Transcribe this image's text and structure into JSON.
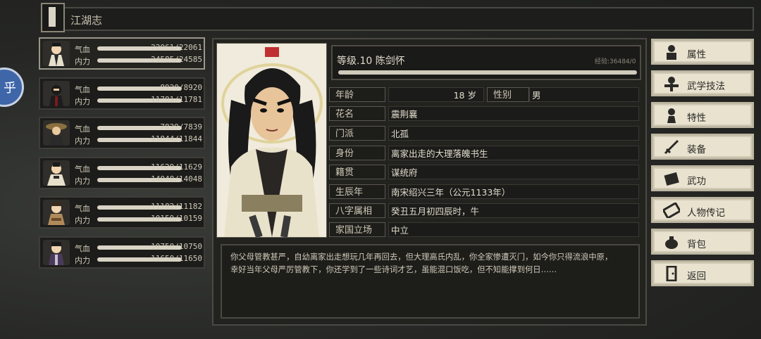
{
  "header": {
    "title": "江湖志"
  },
  "side": {
    "circle_char": "乎"
  },
  "roster": [
    {
      "hp_label": "气血",
      "mp_label": "内力",
      "hp": "22061/22061",
      "mp": "24585/24585",
      "active": true
    },
    {
      "hp_label": "气血",
      "mp_label": "内力",
      "hp": "8920/8920",
      "mp": "11781/11781",
      "active": false
    },
    {
      "hp_label": "气血",
      "mp_label": "内力",
      "hp": "7839/7839",
      "mp": "11844/11844",
      "active": false
    },
    {
      "hp_label": "气血",
      "mp_label": "内力",
      "hp": "11629/11629",
      "mp": "14048/14048",
      "active": false
    },
    {
      "hp_label": "气血",
      "mp_label": "内力",
      "hp": "11182/11182",
      "mp": "10159/10159",
      "active": false
    },
    {
      "hp_label": "气血",
      "mp_label": "内力",
      "hp": "10750/10750",
      "mp": "11650/11650",
      "active": false
    }
  ],
  "character": {
    "level_name": "等级.10 陈剑怀",
    "exp": "经验:36484/0",
    "age_label": "年龄",
    "age_value": "18 岁",
    "gender_label": "性别",
    "gender_value": "男",
    "fields": [
      {
        "label": "花名",
        "value": "震荆襄"
      },
      {
        "label": "门派",
        "value": "北孤"
      },
      {
        "label": "身份",
        "value": "离家出走的大理落魄书生"
      },
      {
        "label": "籍贯",
        "value": "谋统府"
      },
      {
        "label": "生辰年",
        "value": "南宋绍兴三年（公元1133年）"
      },
      {
        "label": "八字属相",
        "value": "癸丑五月初四辰时，牛"
      },
      {
        "label": "家国立场",
        "value": "中立"
      }
    ],
    "bio_line1": "你父母管教甚严，自幼离家出走想玩几年再回去，但大理高氏内乱，你全家惨遭灭门，如今你只得流浪中原，",
    "bio_line2": "幸好当年父母严厉管教下，你还学到了一些诗词才艺，虽能混口饭吃，但不知能撑到何日……"
  },
  "menu": [
    {
      "label": "属性",
      "icon": "person-icon"
    },
    {
      "label": "武学技法",
      "icon": "martial-skill-icon"
    },
    {
      "label": "特性",
      "icon": "trait-icon"
    },
    {
      "label": "装备",
      "icon": "sword-icon"
    },
    {
      "label": "武功",
      "icon": "manual-icon"
    },
    {
      "label": "人物传记",
      "icon": "biography-icon"
    },
    {
      "label": "背包",
      "icon": "bag-icon"
    },
    {
      "label": "返回",
      "icon": "door-icon"
    }
  ]
}
